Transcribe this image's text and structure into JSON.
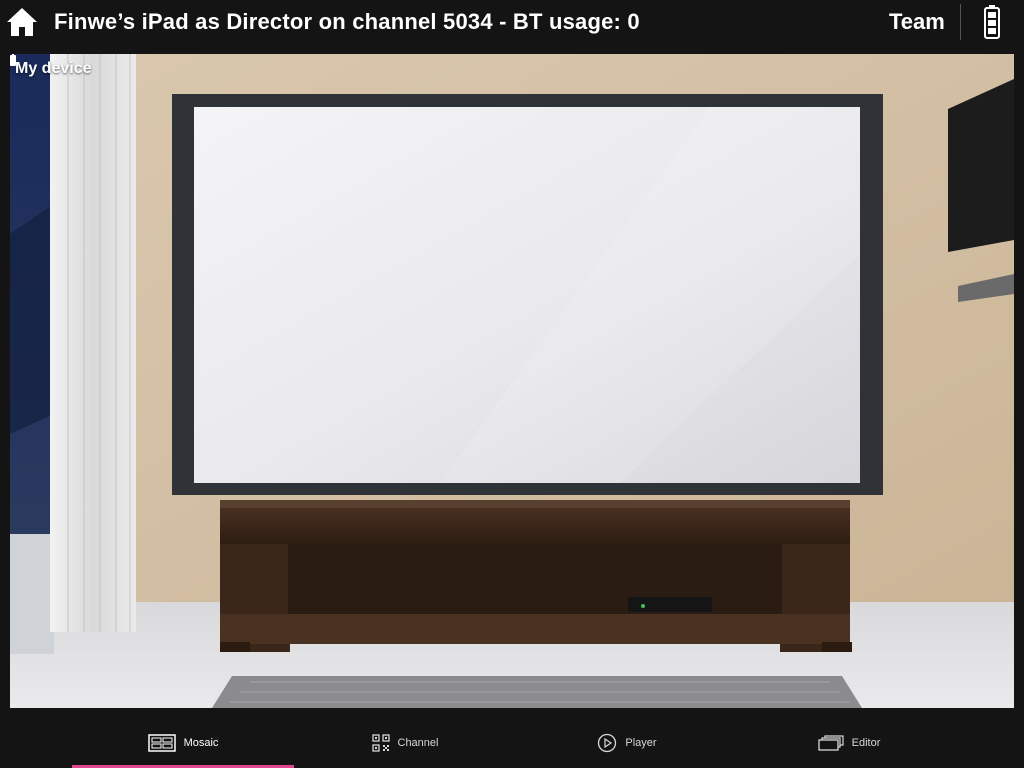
{
  "header": {
    "title": "Finwe’s iPad as Director on channel 5034 - BT usage: 0",
    "team_label": "Team",
    "home_icon": "home-icon",
    "battery_icon": "battery-icon"
  },
  "viewport": {
    "device_label": "My device",
    "battery_icon": "battery-icon"
  },
  "tabs": [
    {
      "label": "Mosaic",
      "icon": "mosaic-icon",
      "active": true
    },
    {
      "label": "Channel",
      "icon": "qr-code-icon",
      "active": false
    },
    {
      "label": "Player",
      "icon": "play-circle-icon",
      "active": false
    },
    {
      "label": "Editor",
      "icon": "editor-stack-icon",
      "active": false
    }
  ],
  "colors": {
    "accent": "#e0458f",
    "bar_background": "#141414"
  }
}
